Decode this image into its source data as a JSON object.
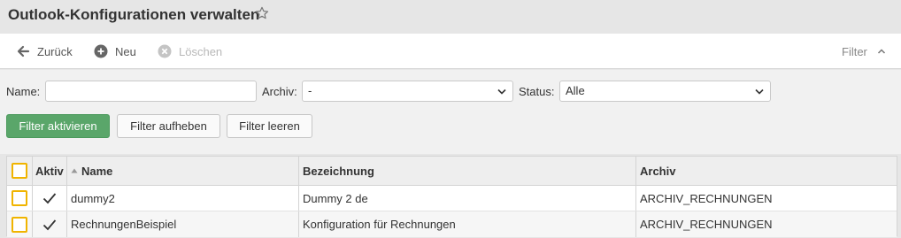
{
  "header": {
    "title": "Outlook-Konfigurationen verwalten",
    "favorite_icon": "star-outline-icon"
  },
  "toolbar": {
    "back_label": "Zurück",
    "new_label": "Neu",
    "delete_label": "Löschen",
    "filter_label": "Filter"
  },
  "filters": {
    "name_label": "Name:",
    "name_value": "",
    "archive_label": "Archiv:",
    "archive_value": "-",
    "status_label": "Status:",
    "status_value": "Alle",
    "activate_button": "Filter aktivieren",
    "remove_button": "Filter aufheben",
    "clear_button": "Filter leeren"
  },
  "table": {
    "columns": {
      "active": "Aktiv",
      "name": "Name",
      "description": "Bezeichnung",
      "archive": "Archiv"
    },
    "sort_column": "name",
    "sort_direction": "ascending",
    "rows": [
      {
        "active": true,
        "name": "dummy2",
        "description": "Dummy 2 de",
        "archive": "ARCHIV_RECHNUNGEN"
      },
      {
        "active": true,
        "name": "RechnungenBeispiel",
        "description": "Konfiguration für Rechnungen",
        "archive": "ARCHIV_RECHNUNGEN"
      }
    ]
  },
  "colors": {
    "primary_button": "#5aa66a",
    "checkbox_border": "#f0b400",
    "background": "#e6e6e6"
  }
}
